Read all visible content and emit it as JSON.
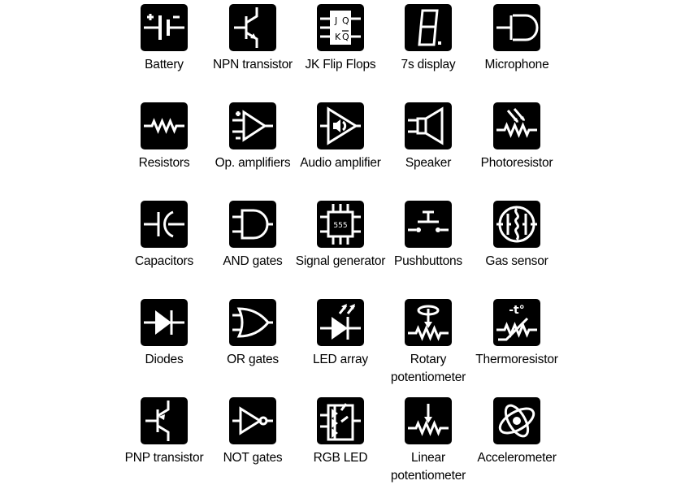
{
  "colors": {
    "icon_background": "#000000",
    "icon_glyph": "#ffffff",
    "label": "#000000"
  },
  "items": [
    {
      "label": "Battery",
      "icon": "battery-icon"
    },
    {
      "label": "NPN transistor",
      "icon": "npn-transistor-icon"
    },
    {
      "label": "JK Flip Flops",
      "icon": "jk-flip-flop-icon",
      "glyph_text": [
        "J",
        "Q",
        "K",
        "Q"
      ]
    },
    {
      "label": "7s display",
      "icon": "seven-segment-display-icon"
    },
    {
      "label": "Microphone",
      "icon": "microphone-icon"
    },
    {
      "label": "Resistors",
      "icon": "resistor-icon"
    },
    {
      "label": "Op. amplifiers",
      "icon": "op-amp-icon"
    },
    {
      "label": "Audio amplifier",
      "icon": "audio-amplifier-icon"
    },
    {
      "label": "Speaker",
      "icon": "speaker-icon"
    },
    {
      "label": "Photoresistor",
      "icon": "photoresistor-icon"
    },
    {
      "label": "Capacitors",
      "icon": "capacitor-icon"
    },
    {
      "label": "AND gates",
      "icon": "and-gate-icon"
    },
    {
      "label": "Signal generator",
      "icon": "signal-generator-icon",
      "glyph_text": [
        "555"
      ]
    },
    {
      "label": "Pushbuttons",
      "icon": "pushbutton-icon"
    },
    {
      "label": "Gas sensor",
      "icon": "gas-sensor-icon"
    },
    {
      "label": "Diodes",
      "icon": "diode-icon"
    },
    {
      "label": "OR gates",
      "icon": "or-gate-icon"
    },
    {
      "label": "LED array",
      "icon": "led-icon"
    },
    {
      "label": "Rotary potentiometer",
      "icon": "rotary-potentiometer-icon"
    },
    {
      "label": "Thermoresistor",
      "icon": "thermoresistor-icon",
      "glyph_text": [
        "-t°"
      ]
    },
    {
      "label": "PNP transistor",
      "icon": "pnp-transistor-icon"
    },
    {
      "label": "NOT gates",
      "icon": "not-gate-icon"
    },
    {
      "label": "RGB LED",
      "icon": "rgb-led-icon"
    },
    {
      "label": "Linear potentiometer",
      "icon": "linear-potentiometer-icon"
    },
    {
      "label": "Accelerometer",
      "icon": "accelerometer-icon"
    }
  ]
}
